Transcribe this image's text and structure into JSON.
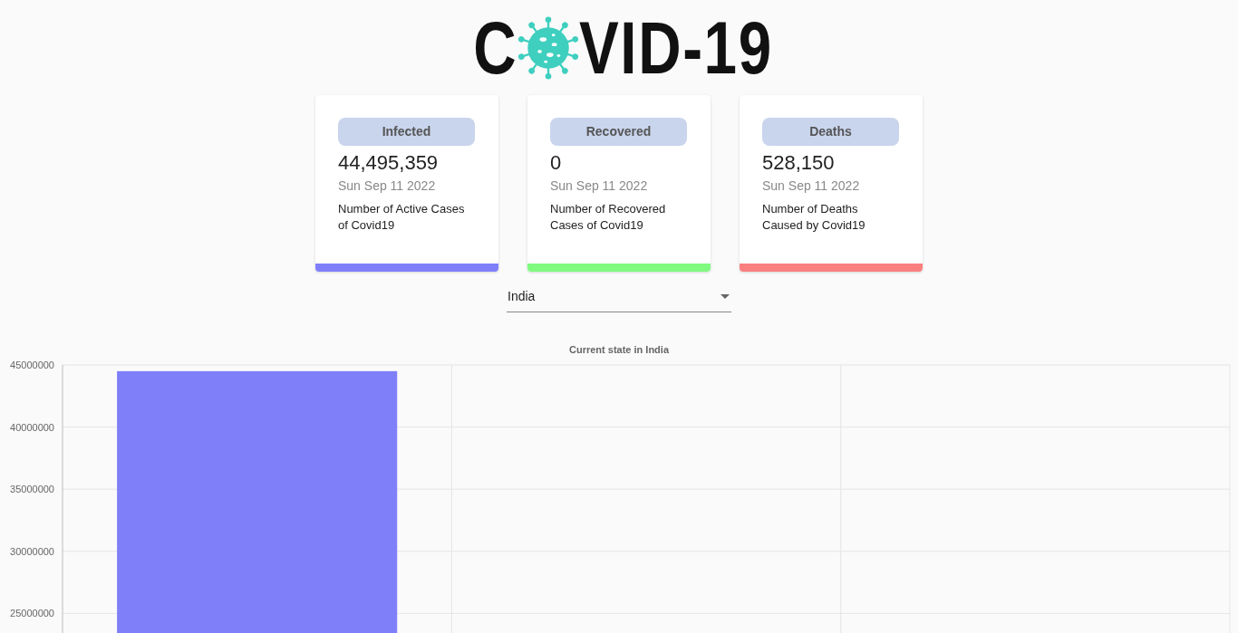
{
  "logo": {
    "text_before": "C",
    "text_after": "VID-19"
  },
  "cards": [
    {
      "title": "Infected",
      "value": "44,495,359",
      "date": "Sun Sep 11 2022",
      "description": "Number of Active Cases of Covid19",
      "color": "#7f7ffa"
    },
    {
      "title": "Recovered",
      "value": "0",
      "date": "Sun Sep 11 2022",
      "description": "Number of Recovered Cases of Covid19",
      "color": "#80fa7f"
    },
    {
      "title": "Deaths",
      "value": "528,150",
      "date": "Sun Sep 11 2022",
      "description": "Number of Deaths Caused by Covid19",
      "color": "#fa7f7f"
    }
  ],
  "country_select": {
    "value": "India"
  },
  "chart": {
    "chart_data": {
      "type": "bar",
      "title": "Current state in India",
      "categories": [
        null,
        null,
        null
      ],
      "values": [
        44500000,
        null,
        null
      ],
      "grid": true,
      "ylim": [
        23400000,
        45000000
      ],
      "yticks": [
        25000000,
        30000000,
        35000000,
        40000000,
        45000000
      ]
    }
  }
}
